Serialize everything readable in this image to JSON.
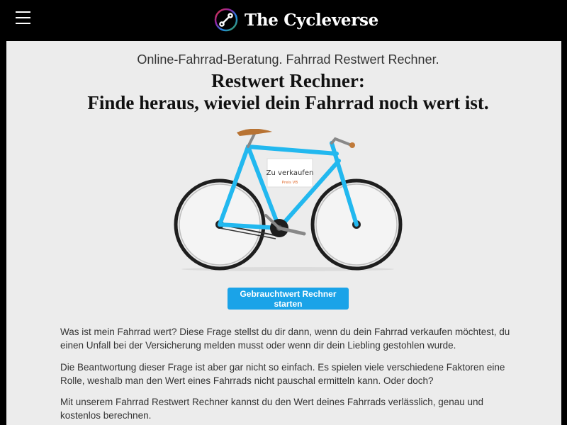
{
  "header": {
    "brand_name": "The Cycleverse",
    "menu_icon": "hamburger-menu-icon",
    "logo_icon": "chain-link-logo-icon"
  },
  "main": {
    "subtitle": "Online-Fahrrad-Beratung. Fahrrad Restwert Rechner.",
    "heading_line1": "Restwert Rechner:",
    "heading_line2": "Finde heraus, wieviel dein Fahrrad noch wert ist.",
    "illustration": {
      "sign_title": "Zu verkaufen",
      "sign_sub": "Preis VB"
    },
    "cta_label": "Gebrauchtwert Rechner starten",
    "paragraphs": [
      "Was ist mein Fahrrad wert? Diese Frage stellst du dir dann, wenn du dein Fahrrad verkaufen möchtest, du einen Unfall bei der Versicherung melden musst oder wenn dir dein Liebling gestohlen wurde.",
      "Die Beantwortung dieser Frage ist aber gar nicht so einfach. Es spielen viele verschiedene Faktoren eine Rolle, weshalb man den Wert eines Fahrrads nicht pauschal ermitteln kann. Oder doch?",
      "Mit unserem Fahrrad Restwert Rechner kannst du den Wert deines Fahrrads verlässlich, genau und kostenlos berechnen."
    ]
  },
  "colors": {
    "header_bg": "#000000",
    "page_bg": "#ececec",
    "accent": "#1aa3e8",
    "frame": "#22b8ef",
    "saddle": "#b87333"
  }
}
